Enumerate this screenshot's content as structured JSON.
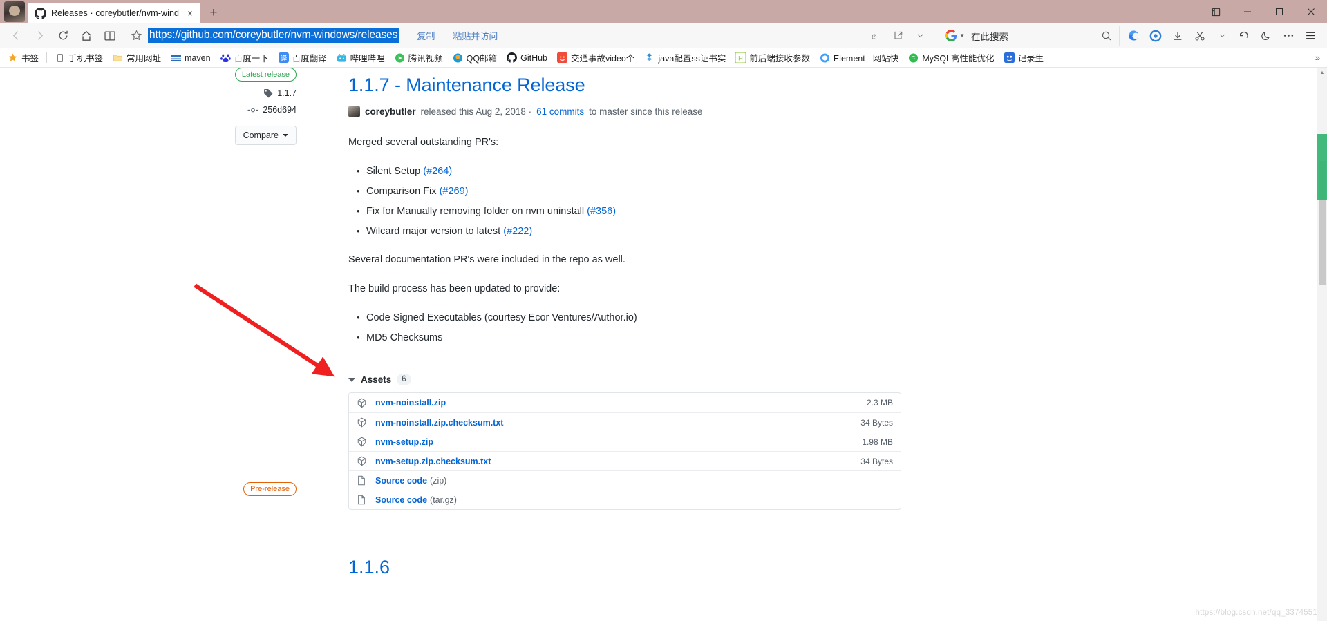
{
  "window": {
    "tab": {
      "title": "Releases · coreybutler/nvm-wind",
      "favicon": "github-icon",
      "close": "×"
    },
    "new_tab_label": "+",
    "controls": {
      "collections": "collections-icon",
      "minimize": "—",
      "maximize": "□",
      "close": "✕"
    }
  },
  "nav": {
    "back": "‹",
    "forward": "›",
    "refresh": "refresh-icon",
    "home": "home-icon",
    "reading_list": "book-icon",
    "favorite": "star-icon"
  },
  "address_bar": {
    "url": "https://github.com/coreybutler/nvm-windows/releases",
    "copy_label": "复制",
    "paste_go_label": "粘贴并访问",
    "ie_mode": "ie-icon",
    "share": "share-icon",
    "chevron": "chevron-down-icon"
  },
  "search": {
    "engine": "google-icon",
    "placeholder": "在此搜索",
    "magnifier": "search-icon"
  },
  "toolbar_right": {
    "items": [
      {
        "name": "firefox-icon"
      },
      {
        "name": "browser-circle-icon"
      },
      {
        "name": "download-icon"
      },
      {
        "name": "scissors-icon"
      },
      {
        "name": "chevron-down-icon"
      },
      {
        "name": "undo-icon"
      },
      {
        "name": "moon-icon"
      },
      {
        "name": "more-icon"
      },
      {
        "name": "menu-icon"
      }
    ]
  },
  "bookmarks": {
    "items": [
      {
        "label": "书签",
        "icon": "star-orange-icon"
      },
      {
        "label": "手机书签",
        "icon": "phone-icon"
      },
      {
        "label": "常用网址",
        "icon": "folder-icon"
      },
      {
        "label": "maven",
        "icon": "maven-icon"
      },
      {
        "label": "百度一下",
        "icon": "baidu-icon"
      },
      {
        "label": "百度翻译",
        "icon": "baidu-fanyi-icon"
      },
      {
        "label": "哔哩哔哩",
        "icon": "bilibili-icon"
      },
      {
        "label": "腾讯视频",
        "icon": "tencent-video-icon"
      },
      {
        "label": "QQ邮箱",
        "icon": "qqmail-icon"
      },
      {
        "label": "GitHub",
        "icon": "github-icon"
      },
      {
        "label": "交通事故video个",
        "icon": "video-icon"
      },
      {
        "label": "java配置ss证书实",
        "icon": "java-icon"
      },
      {
        "label": "前后端接收参数",
        "icon": "h-icon"
      },
      {
        "label": "Element - 网站快",
        "icon": "element-icon"
      },
      {
        "label": "MySQL高性能优化",
        "icon": "mysql-icon"
      },
      {
        "label": "记录生",
        "icon": "record-icon"
      }
    ],
    "overflow": "»"
  },
  "release": {
    "badge": "Latest release",
    "tag": "1.1.7",
    "commit": "256d694",
    "compare_label": "Compare",
    "title": "1.1.7 - Maintenance Release",
    "author": "coreybutler",
    "released_text": "released this Aug 2, 2018 ·",
    "commits_link": "61 commits",
    "branch_text": "to master since this release",
    "intro": "Merged several outstanding PR's:",
    "pr_list": [
      {
        "text": "Silent Setup",
        "link": "(#264)"
      },
      {
        "text": "Comparison Fix",
        "link": "(#269)"
      },
      {
        "text": "Fix for Manually removing folder on nvm uninstall",
        "link": "(#356)"
      },
      {
        "text": "Wilcard major version to latest",
        "link": "(#222)"
      }
    ],
    "docs_note": "Several documentation PR's were included in the repo as well.",
    "build_note": "The build process has been updated to provide:",
    "build_list": [
      "Code Signed Executables (courtesy Ecor Ventures/Author.io)",
      "MD5 Checksums"
    ]
  },
  "assets": {
    "label": "Assets",
    "count": "6",
    "rows": [
      {
        "icon": "package-icon",
        "name": "nvm-noinstall.zip",
        "suffix": "",
        "size": "2.3 MB"
      },
      {
        "icon": "package-icon",
        "name": "nvm-noinstall.zip.checksum.txt",
        "suffix": "",
        "size": "34 Bytes"
      },
      {
        "icon": "package-icon",
        "name": "nvm-setup.zip",
        "suffix": "",
        "size": "1.98 MB"
      },
      {
        "icon": "package-icon",
        "name": "nvm-setup.zip.checksum.txt",
        "suffix": "",
        "size": "34 Bytes"
      },
      {
        "icon": "file-icon",
        "name": "Source code",
        "suffix": "(zip)",
        "size": ""
      },
      {
        "icon": "file-icon",
        "name": "Source code",
        "suffix": "(tar.gz)",
        "size": ""
      }
    ]
  },
  "next_release": {
    "badge": "Pre-release",
    "title": "1.1.6"
  },
  "watermark": "https://blog.csdn.net/qq_3374551",
  "colors": {
    "accent_link": "#0366d6",
    "titlebar": "#c8a9a6",
    "url_selection": "#0a6fd8",
    "latest_release": "#2ea44f",
    "pre_release": "#e36209",
    "annotation_arrow": "#f02020"
  }
}
